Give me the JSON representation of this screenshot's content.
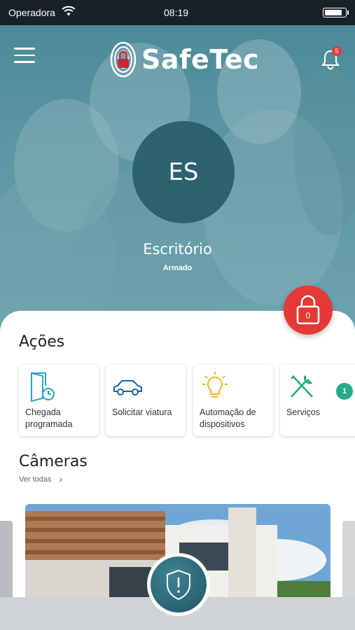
{
  "status_bar": {
    "carrier": "Operadora",
    "time": "08:19",
    "battery_level": 0.85
  },
  "header": {
    "logo_text": "SafeTec",
    "notifications_count": "5"
  },
  "hero": {
    "initials": "ES",
    "place_name": "Escritório",
    "place_status": "Armado"
  },
  "lock": {
    "count": "0"
  },
  "actions": {
    "title": "Ações",
    "items": [
      {
        "label": "Chegada programada",
        "icon": "door-clock-icon"
      },
      {
        "label": "Solicitar viatura",
        "icon": "car-icon"
      },
      {
        "label": "Automação de dispositivos",
        "icon": "lightbulb-icon"
      },
      {
        "label": "Serviços",
        "icon": "tools-icon",
        "badge": "1"
      }
    ]
  },
  "cameras": {
    "title": "Câmeras",
    "see_all": "Ver todas"
  },
  "colors": {
    "brand_teal": "#2e7383",
    "alert_red": "#e53935",
    "badge_green": "#26a987"
  }
}
